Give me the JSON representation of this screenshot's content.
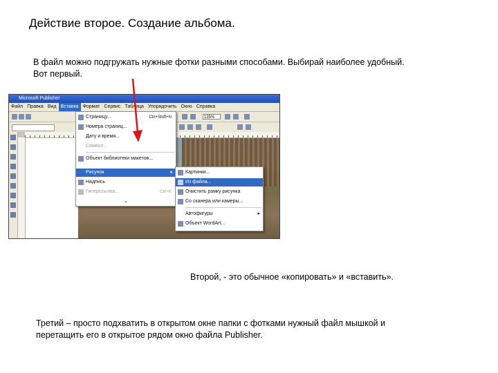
{
  "heading": "Действие второе. Создание альбома.",
  "paragraph1": "В файл можно подгружать нужные фотки разными способами. Выбирай наиболее удобный. Вот первый.",
  "paragraph2": "Второй, - это обычное «копировать» и «вставить».",
  "paragraph3": "Третий – просто подхватить в открытом окне папки с фотками нужный файл мышкой и перетащить его в открытое рядом окно файла Publisher.",
  "screenshot": {
    "window_title": "Microsoft Publisher",
    "menubar": [
      "Файл",
      "Правка",
      "Вид",
      "Вставка",
      "Формат",
      "Сервис",
      "Таблица",
      "Упорядочить",
      "Окно",
      "Справка"
    ],
    "active_menu_index": 3,
    "zoom": "135%",
    "insert_menu": [
      {
        "label": "Страницу...",
        "shortcut": "Ctrl+Shift+N"
      },
      {
        "label": "Номера страниц..."
      },
      {
        "label": "Дату и время..."
      },
      {
        "label": "Символ...",
        "disabled": true
      },
      {
        "label": "Объект библиотеки макетов..."
      },
      {
        "label": "Рисунок",
        "submenu": true,
        "highlighted": true
      },
      {
        "label": "Надпись"
      },
      {
        "label": "Гиперссылка...",
        "shortcut": "Ctrl+K",
        "disabled": true
      }
    ],
    "picture_submenu": [
      {
        "label": "Картинки..."
      },
      {
        "label": "Из файла...",
        "highlighted": true
      },
      {
        "label": "Очистить рамку рисунка"
      },
      {
        "label": "Со сканера или камеры..."
      },
      {
        "label": "Автофигуры"
      },
      {
        "label": "Объект WordArt..."
      }
    ]
  },
  "colors": {
    "arrow": "#e0121b",
    "menu_highlight": "#316ac5",
    "titlebar": "#2a5cc8"
  }
}
